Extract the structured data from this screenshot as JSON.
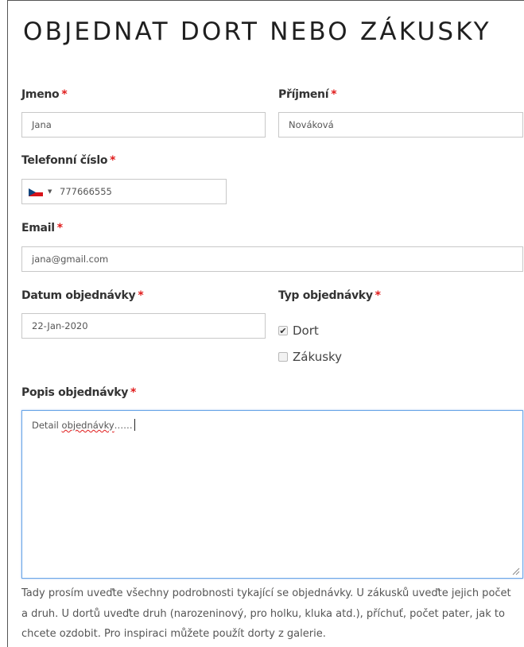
{
  "form": {
    "title": "OBJEDNAT DORT NEBO ZÁKUSKY",
    "required_mark": "*",
    "first_name": {
      "label": "Jmeno",
      "value": "Jana"
    },
    "last_name": {
      "label": "Příjmení",
      "value": "Nováková"
    },
    "phone": {
      "label": "Telefonní číslo",
      "country": "CZ",
      "caret": "▼",
      "value": "777666555"
    },
    "email": {
      "label": "Email",
      "value": "jana@gmail.com"
    },
    "order_date": {
      "label": "Datum objednávky",
      "value": "22-Jan-2020"
    },
    "order_type": {
      "label": "Typ objednávky",
      "options": [
        {
          "label": "Dort",
          "checked": true
        },
        {
          "label": "Zákusky",
          "checked": false
        }
      ]
    },
    "description": {
      "label": "Popis objednávky",
      "value_prefix": "Detail ",
      "value_misspelled": "objednávky",
      "value_suffix": "……"
    },
    "help_text": "Tady prosím uveďte všechny podrobnosti tykající se objednávky. U zákusků uveďte jejich počet a druh. U dortů uveďte druh (narozeninový, pro holku, kluka atd.), příchuť, počet pater, jak to chcete ozdobit. Pro inspiraci můžete použít dorty z galerie."
  },
  "colors": {
    "required": "#e01b1b",
    "focus_border": "#6aa6e8",
    "input_border": "#c8c8c8"
  }
}
